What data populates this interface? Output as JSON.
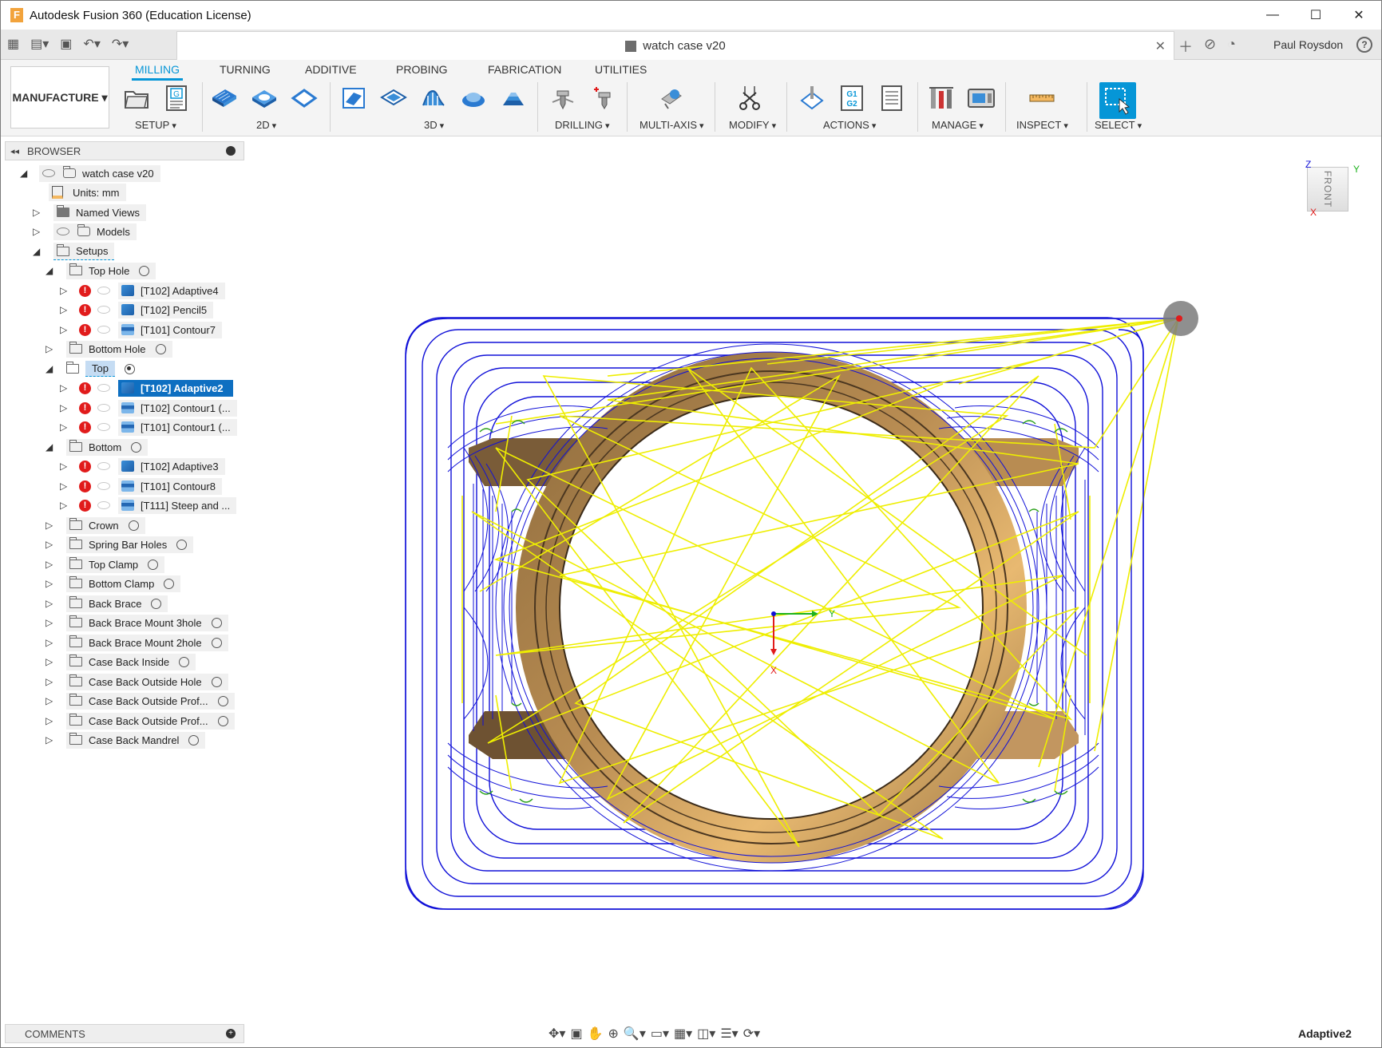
{
  "window": {
    "title": "Autodesk Fusion 360 (Education License)",
    "minimize": "—",
    "maximize": "☐",
    "close": "✕"
  },
  "tabbar": {
    "document_title": "watch case v20",
    "user": "Paul Roysdon",
    "help": "?"
  },
  "toolbar": {
    "workspace": "MANUFACTURE ▾",
    "tabs": [
      "MILLING",
      "TURNING",
      "ADDITIVE",
      "PROBING",
      "FABRICATION",
      "UTILITIES"
    ],
    "groups": [
      "SETUP",
      "2D",
      "3D",
      "DRILLING",
      "MULTI-AXIS",
      "MODIFY",
      "ACTIONS",
      "MANAGE",
      "INSPECT",
      "SELECT"
    ]
  },
  "browser": {
    "header": "BROWSER",
    "root": "watch case v20",
    "units": "Units: mm",
    "named_views": "Named Views",
    "models": "Models",
    "setups": "Setups",
    "nodes": [
      "Top Hole",
      "[T102] Adaptive4",
      "[T102] Pencil5",
      "[T101] Contour7",
      "Bottom Hole",
      "Top",
      "[T102] Adaptive2",
      "[T102] Contour1 (...",
      "[T101] Contour1 (...",
      "Bottom",
      "[T102] Adaptive3",
      "[T101] Contour8",
      "[T111] Steep and ...",
      "Crown",
      "Spring Bar Holes",
      "Top Clamp",
      "Bottom Clamp",
      "Back Brace",
      "Back Brace Mount 3hole",
      "Back Brace Mount 2hole",
      "Case Back Inside",
      "Case Back Outside Hole",
      "Case Back Outside Prof...",
      "Case Back Outside Prof...",
      "Case Back Mandrel"
    ]
  },
  "comments": "COMMENTS",
  "status": {
    "active_operation": "Adaptive2"
  },
  "viewcube": {
    "face": "FRONT",
    "axis_z": "Z",
    "axis_y": "Y",
    "axis_x": "X"
  },
  "triad": {
    "y": "Y",
    "x": "X"
  },
  "colors": {
    "accent": "#0696d7",
    "toolpath_cut": "#1010d8",
    "toolpath_rapid": "#f0f000",
    "stock_gold": "#d7a45a",
    "error": "#e11b1b"
  }
}
